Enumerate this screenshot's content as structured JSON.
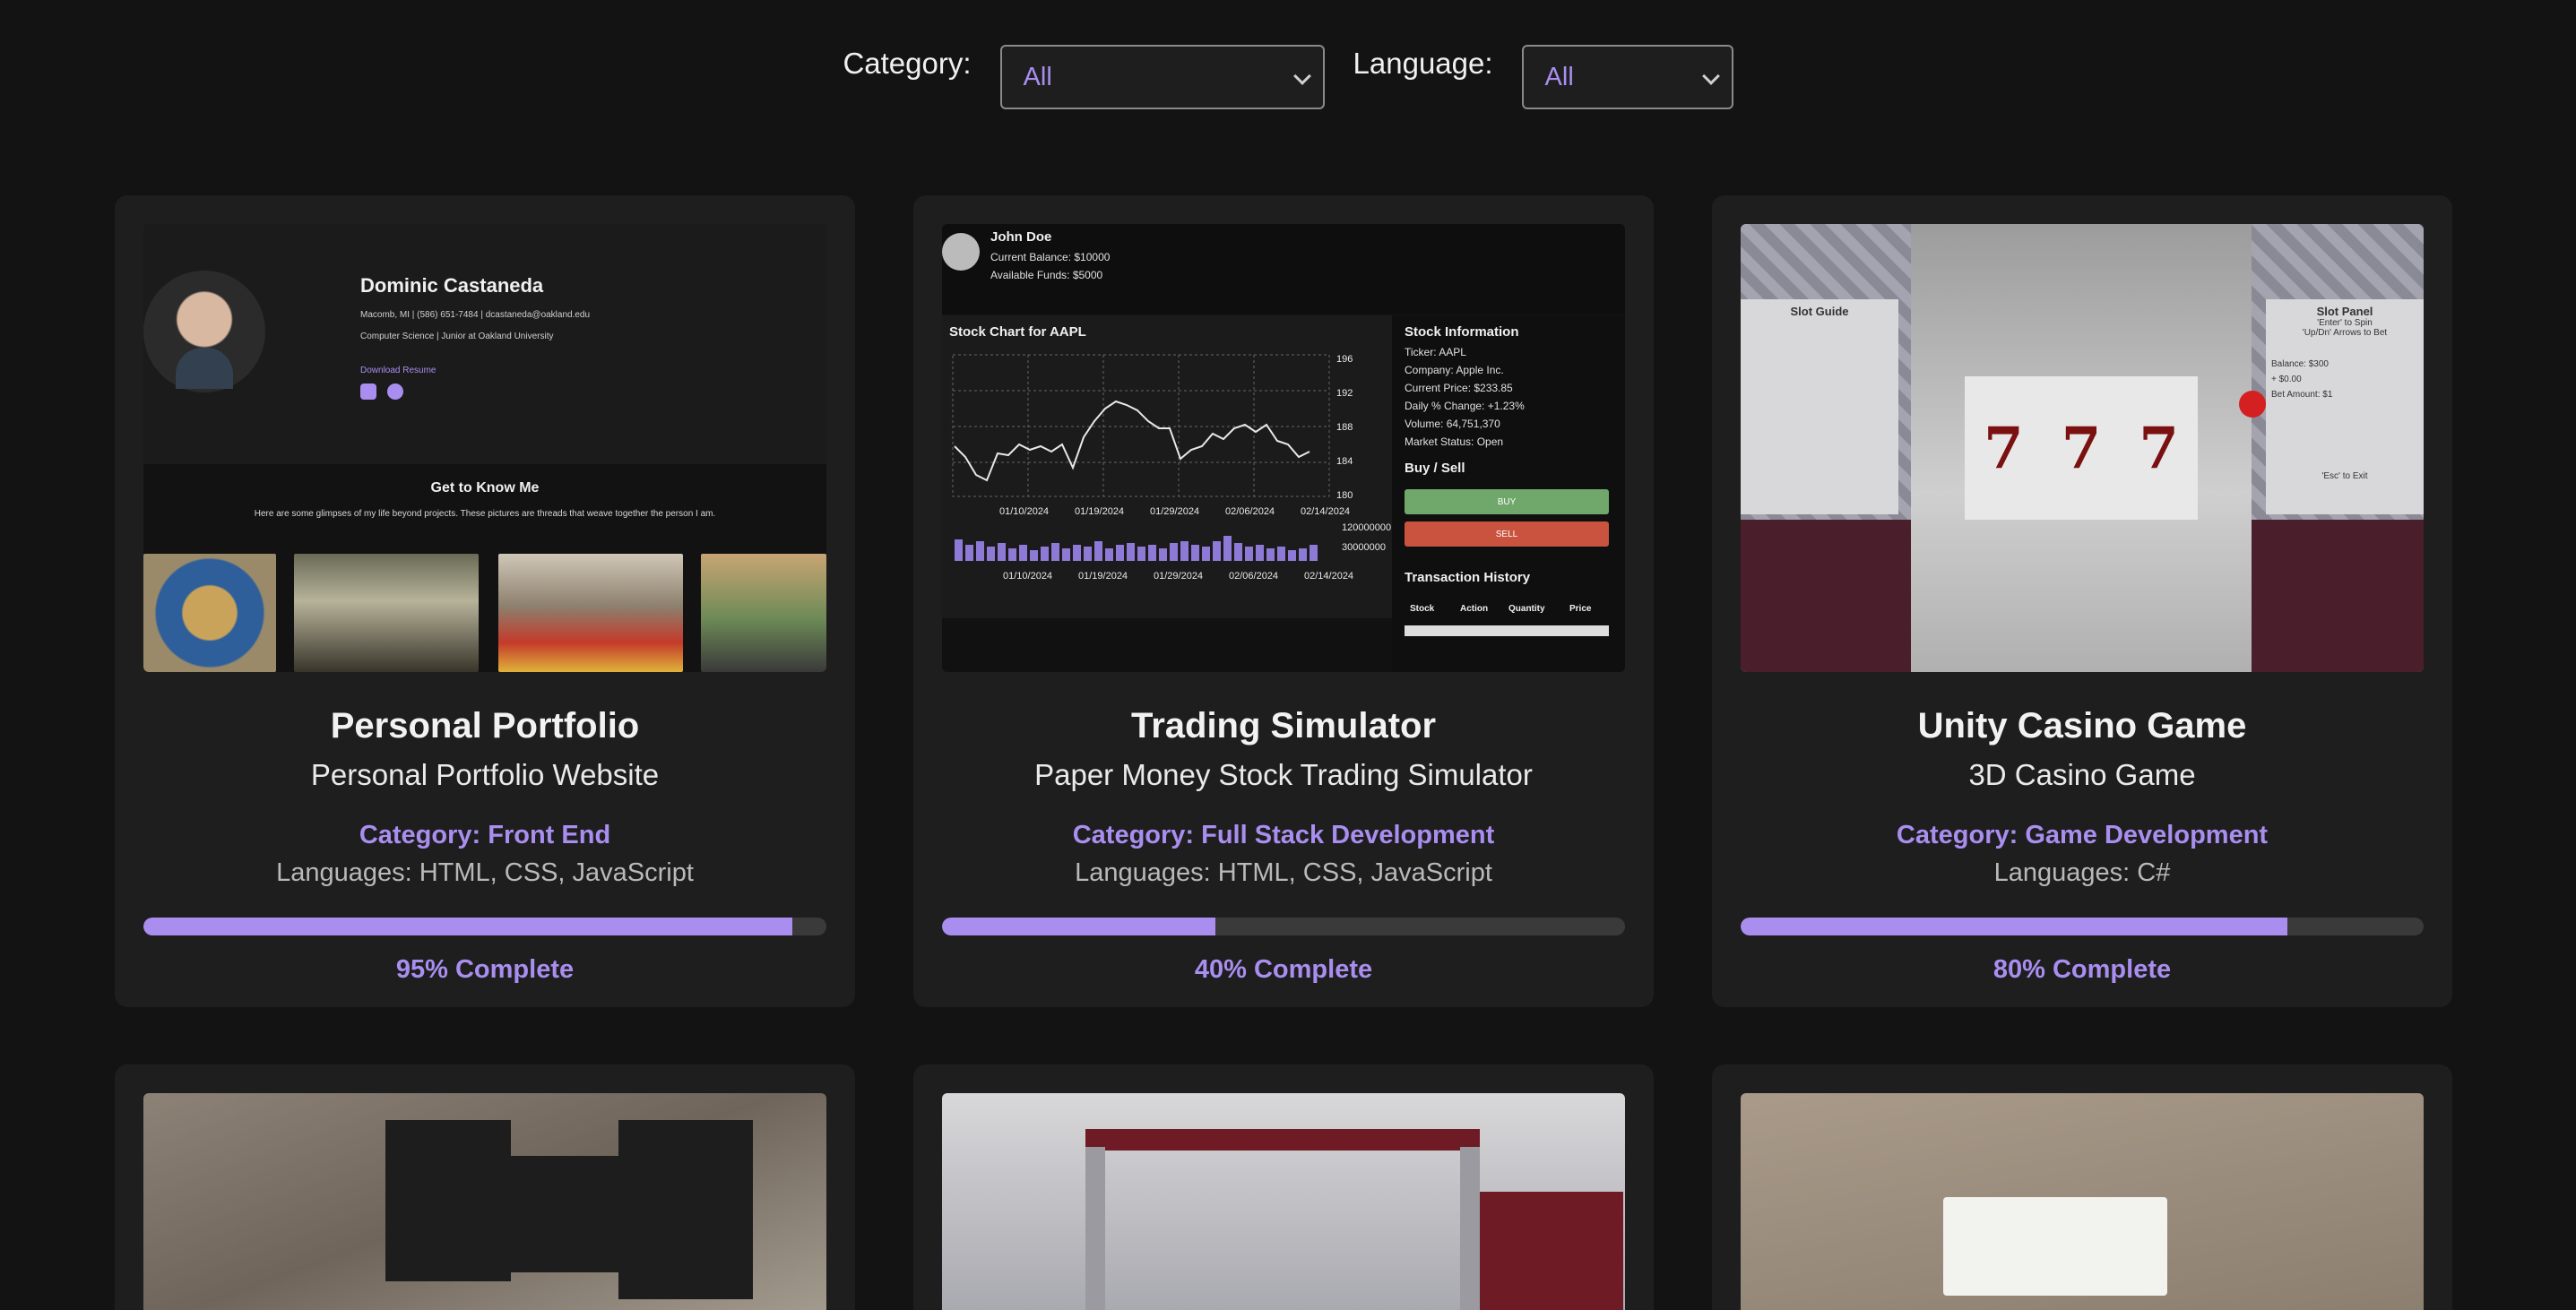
{
  "filters": {
    "category_label": "Category:",
    "category_value": "All",
    "language_label": "Language:",
    "language_value": "All"
  },
  "projects": [
    {
      "title": "Personal Portfolio",
      "subtitle": "Personal Portfolio Website",
      "category": "Category: Front End",
      "languages": "Languages: HTML, CSS, JavaScript",
      "progress": 95,
      "progress_text": "95% Complete",
      "preview": {
        "name": "Dominic Castaneda",
        "contact": "Macomb, MI | (586) 651-7484 | dcastaneda@oakland.edu",
        "education": "Computer Science | Junior at Oakland University",
        "resume_link": "Download Resume",
        "section_title": "Get to Know Me",
        "section_text": "Here are some glimpses of my life beyond projects. These pictures are threads that weave together the person I am."
      }
    },
    {
      "title": "Trading Simulator",
      "subtitle": "Paper Money Stock Trading Simulator",
      "category": "Category: Full Stack Development",
      "languages": "Languages: HTML, CSS, JavaScript",
      "progress": 40,
      "progress_text": "40% Complete",
      "preview": {
        "user": "John Doe",
        "balance": "Current Balance: $10000",
        "funds": "Available Funds: $5000",
        "chart_title": "Stock Chart for AAPL",
        "info_title": "Stock Information",
        "info_rows": [
          "Ticker: AAPL",
          "Company: Apple Inc.",
          "Current Price: $233.85",
          "Daily % Change: +1.23%",
          "Volume: 64,751,370",
          "Market Status: Open"
        ],
        "buy_sell_title": "Buy / Sell",
        "buy": "BUY",
        "sell": "SELL",
        "history_title": "Transaction History",
        "history_cols": [
          "Stock",
          "Action",
          "Quantity",
          "Price"
        ],
        "dates": [
          "01/10/2024",
          "01/19/2024",
          "01/29/2024",
          "02/06/2024",
          "02/14/2024"
        ],
        "y_ticks": [
          "196",
          "192",
          "188",
          "184",
          "180"
        ],
        "vol_ticks": [
          "120000000",
          "30000000"
        ]
      }
    },
    {
      "title": "Unity Casino Game",
      "subtitle": "3D Casino Game",
      "category": "Category: Game Development",
      "languages": "Languages: C#",
      "progress": 80,
      "progress_text": "80% Complete",
      "preview": {
        "left_panel_title": "Slot Guide",
        "right_panel_title": "Slot Panel",
        "right_panel_lines": [
          "'Enter' to Spin",
          "'Up/Dn' Arrows to Bet",
          "Balance: $300",
          "+ $0.00",
          "Bet Amount: $1",
          "'Esc' to Exit"
        ],
        "reel_symbol": "7"
      }
    }
  ]
}
